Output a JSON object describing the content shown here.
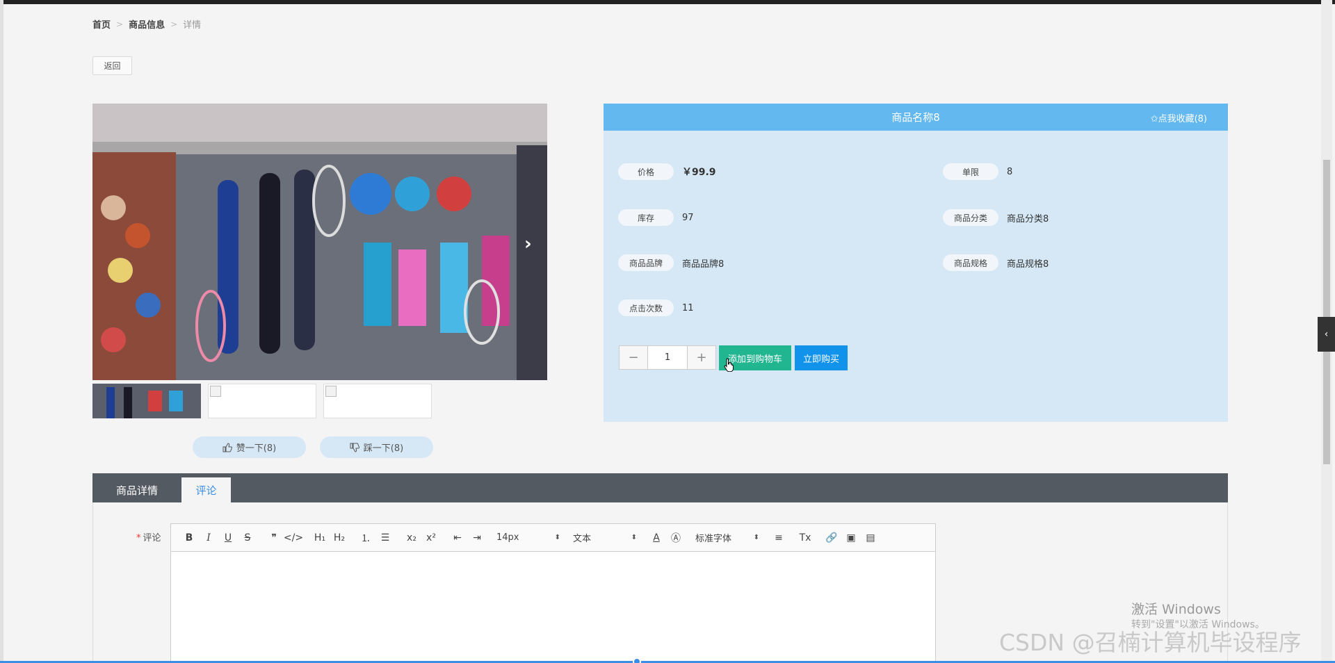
{
  "breadcrumb": {
    "home": "首页",
    "sep1": ">",
    "section": "商品信息",
    "sep2": ">",
    "current": "详情"
  },
  "back_label": "返回",
  "gallery": {
    "next_arrow": "›"
  },
  "votes": {
    "up_label": "赞一下(8)",
    "down_label": "踩一下(8)"
  },
  "product": {
    "name": "商品名称8",
    "favorite_label": "✩点我收藏(8)",
    "fields": {
      "price_label": "价格",
      "price_value": "￥99.9",
      "limit_label": "单限",
      "limit_value": "8",
      "stock_label": "库存",
      "stock_value": "97",
      "category_label": "商品分类",
      "category_value": "商品分类8",
      "brand_label": "商品品牌",
      "brand_value": "商品品牌8",
      "spec_label": "商品规格",
      "spec_value": "商品规格8",
      "clicks_label": "点击次数",
      "clicks_value": "11"
    },
    "quantity": {
      "minus": "−",
      "value": "1",
      "plus": "+"
    },
    "add_to_cart": "添加到购物车",
    "buy_now": "立即购买"
  },
  "tabs": [
    {
      "label": "商品详情"
    },
    {
      "label": "评论"
    }
  ],
  "comment": {
    "required_mark": "*",
    "label": "评论",
    "toolbar": {
      "bold": "B",
      "italic": "I",
      "underline": "U",
      "strike": "S",
      "quote": "❞",
      "code": "</>",
      "h1": "H₁",
      "h2": "H₂",
      "ol": "⒈",
      "ul": "☰",
      "sub": "x₂",
      "sup": "x²",
      "outdent": "⇤",
      "indent": "⇥",
      "size_value": "14px",
      "size_arrow": "⬍",
      "header_value": "文本",
      "header_arrow": "⬍",
      "color": "A",
      "background": "Ⓐ",
      "font_value": "标准字体",
      "font_arrow": "⬍",
      "align": "≡",
      "clean": "Tx",
      "link": "🔗",
      "image": "▣",
      "video": "▤"
    }
  },
  "side_handle": "‹",
  "watermarks": {
    "line1": "激活 Windows",
    "line2": "转到\"设置\"以激活 Windows。",
    "csdn": "CSDN @召楠计算机毕设程序"
  },
  "colors": {
    "header_blue": "#62b8ef",
    "panel_blue": "#d6e8f6",
    "cart_green": "#21b590",
    "buy_blue": "#1193ec",
    "tab_bar": "#545a62",
    "tab_active_text": "#3a8ee6"
  }
}
